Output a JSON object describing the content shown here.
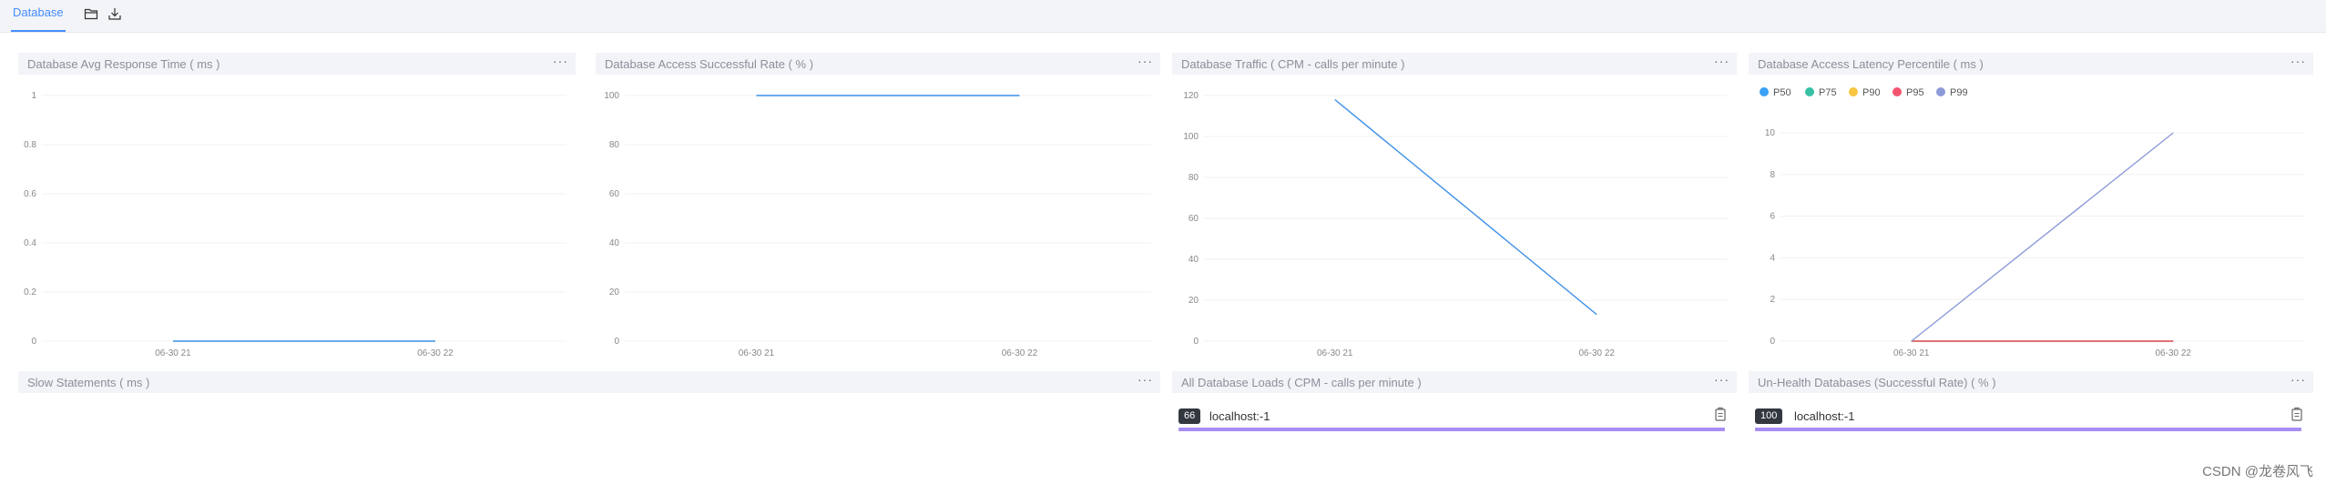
{
  "tabs": {
    "active": "Database"
  },
  "toolbar": {
    "icons": [
      "folder-open-icon",
      "download-icon"
    ]
  },
  "colors": {
    "accent": "#448dfe",
    "line": "#3a8ee6",
    "p50": "#3aa1f6",
    "p75": "#36c0a4",
    "p90": "#f7c542",
    "p95": "#f4556e",
    "p99": "#8c9ad9",
    "bar": "#a88df5"
  },
  "panels": {
    "avg_response": {
      "title": "Database Avg Response Time ( ms )",
      "more": "···"
    },
    "success_rate": {
      "title": "Database Access Successful Rate ( % )",
      "more": "···"
    },
    "traffic": {
      "title": "Database Traffic ( CPM - calls per minute )",
      "more": "···"
    },
    "latency": {
      "title": "Database Access Latency Percentile ( ms )",
      "more": "···"
    },
    "slow": {
      "title": "Slow Statements ( ms )",
      "more": "···"
    },
    "loads": {
      "title": "All Database Loads ( CPM - calls per minute )",
      "more": "···",
      "rows": [
        {
          "value": "66",
          "label": "localhost:-1",
          "fraction": 1.0
        }
      ]
    },
    "unhealth": {
      "title": "Un-Health Databases (Successful Rate) ( % )",
      "more": "···",
      "rows": [
        {
          "value": "100",
          "label": "localhost:-1",
          "fraction": 1.0
        }
      ]
    }
  },
  "legend": [
    "P50",
    "P75",
    "P90",
    "P95",
    "P99"
  ],
  "chart_data": [
    {
      "type": "line",
      "title": "Database Avg Response Time ( ms )",
      "x": [
        "06-30 21",
        "06-30 22"
      ],
      "yticks": [
        "0",
        "0.2",
        "0.4",
        "0.6",
        "0.8",
        "1"
      ],
      "ylim": [
        0,
        1
      ],
      "series": [
        {
          "values": [
            0,
            0
          ]
        }
      ]
    },
    {
      "type": "line",
      "title": "Database Access Successful Rate ( % )",
      "x": [
        "06-30 21",
        "06-30 22"
      ],
      "yticks": [
        "0",
        "20",
        "40",
        "60",
        "80",
        "100"
      ],
      "ylim": [
        0,
        100
      ],
      "series": [
        {
          "values": [
            100,
            100
          ]
        }
      ]
    },
    {
      "type": "line",
      "title": "Database Traffic ( CPM - calls per minute )",
      "x": [
        "06-30 21",
        "06-30 22"
      ],
      "yticks": [
        "0",
        "20",
        "40",
        "60",
        "80",
        "100",
        "120"
      ],
      "ylim": [
        0,
        120
      ],
      "series": [
        {
          "values": [
            118,
            13
          ]
        }
      ]
    },
    {
      "type": "line",
      "title": "Database Access Latency Percentile ( ms )",
      "x": [
        "06-30 21",
        "06-30 22"
      ],
      "yticks": [
        "0",
        "2",
        "4",
        "6",
        "8",
        "10"
      ],
      "ylim": [
        0,
        10
      ],
      "series": [
        {
          "name": "P50",
          "values": [
            0,
            0
          ]
        },
        {
          "name": "P75",
          "values": [
            0,
            0
          ]
        },
        {
          "name": "P90",
          "values": [
            0,
            0
          ]
        },
        {
          "name": "P95",
          "values": [
            0,
            0
          ]
        },
        {
          "name": "P99",
          "values": [
            0,
            10
          ]
        }
      ]
    }
  ],
  "watermark": "CSDN @龙卷风飞"
}
